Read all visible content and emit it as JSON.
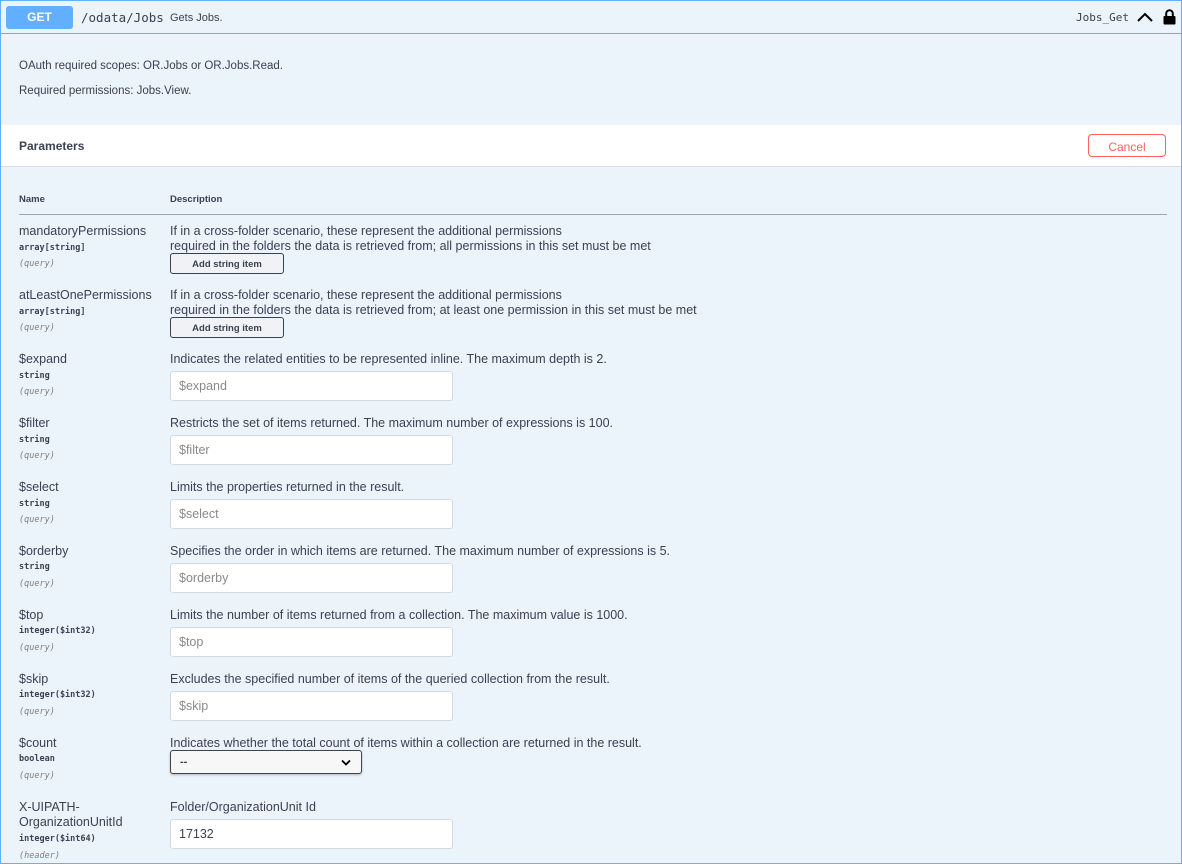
{
  "operation": {
    "method": "GET",
    "path": "/odata/Jobs",
    "summary": "Gets Jobs.",
    "operation_id": "Jobs_Get"
  },
  "description": {
    "line1": "OAuth required scopes: OR.Jobs or OR.Jobs.Read.",
    "line2": "Required permissions: Jobs.View."
  },
  "parameters_section": {
    "title": "Parameters",
    "cancel_label": "Cancel",
    "col_name": "Name",
    "col_description": "Description"
  },
  "params": [
    {
      "name": "mandatoryPermissions",
      "type": "array[string]",
      "in": "(query)",
      "desc1": "If in a cross-folder scenario, these represent the additional permissions",
      "desc2": "required in the folders the data is retrieved from; all permissions in this set must be met",
      "button": "Add string item"
    },
    {
      "name": "atLeastOnePermissions",
      "type": "array[string]",
      "in": "(query)",
      "desc1": "If in a cross-folder scenario, these represent the additional permissions",
      "desc2": "required in the folders the data is retrieved from; at least one permission in this set must be met",
      "button": "Add string item"
    },
    {
      "name": "$expand",
      "type": "string",
      "in": "(query)",
      "desc": "Indicates the related entities to be represented inline. The maximum depth is 2.",
      "placeholder": "$expand",
      "value": ""
    },
    {
      "name": "$filter",
      "type": "string",
      "in": "(query)",
      "desc": "Restricts the set of items returned. The maximum number of expressions is 100.",
      "placeholder": "$filter",
      "value": ""
    },
    {
      "name": "$select",
      "type": "string",
      "in": "(query)",
      "desc": "Limits the properties returned in the result.",
      "placeholder": "$select",
      "value": ""
    },
    {
      "name": "$orderby",
      "type": "string",
      "in": "(query)",
      "desc": "Specifies the order in which items are returned. The maximum number of expressions is 5.",
      "placeholder": "$orderby",
      "value": ""
    },
    {
      "name": "$top",
      "type": "integer($int32)",
      "in": "(query)",
      "desc": "Limits the number of items returned from a collection. The maximum value is 1000.",
      "placeholder": "$top",
      "value": ""
    },
    {
      "name": "$skip",
      "type": "integer($int32)",
      "in": "(query)",
      "desc": "Excludes the specified number of items of the queried collection from the result.",
      "placeholder": "$skip",
      "value": ""
    },
    {
      "name": "$count",
      "type": "boolean",
      "in": "(query)",
      "desc": "Indicates whether the total count of items within a collection are returned in the result.",
      "selected": "--"
    },
    {
      "name1": "X-UIPATH-",
      "name2": "OrganizationUnitId",
      "type": "integer($int64)",
      "in": "(header)",
      "desc": "Folder/OrganizationUnit Id",
      "placeholder": "",
      "value": "17132"
    }
  ],
  "icons": {
    "collapse": "chevron-up-icon",
    "lock": "lock-icon",
    "select_caret": "chevron-down-icon"
  },
  "colors": {
    "get_method": "#61affe",
    "panel_bg": "#ebf3fb",
    "cancel": "#ff6060"
  }
}
